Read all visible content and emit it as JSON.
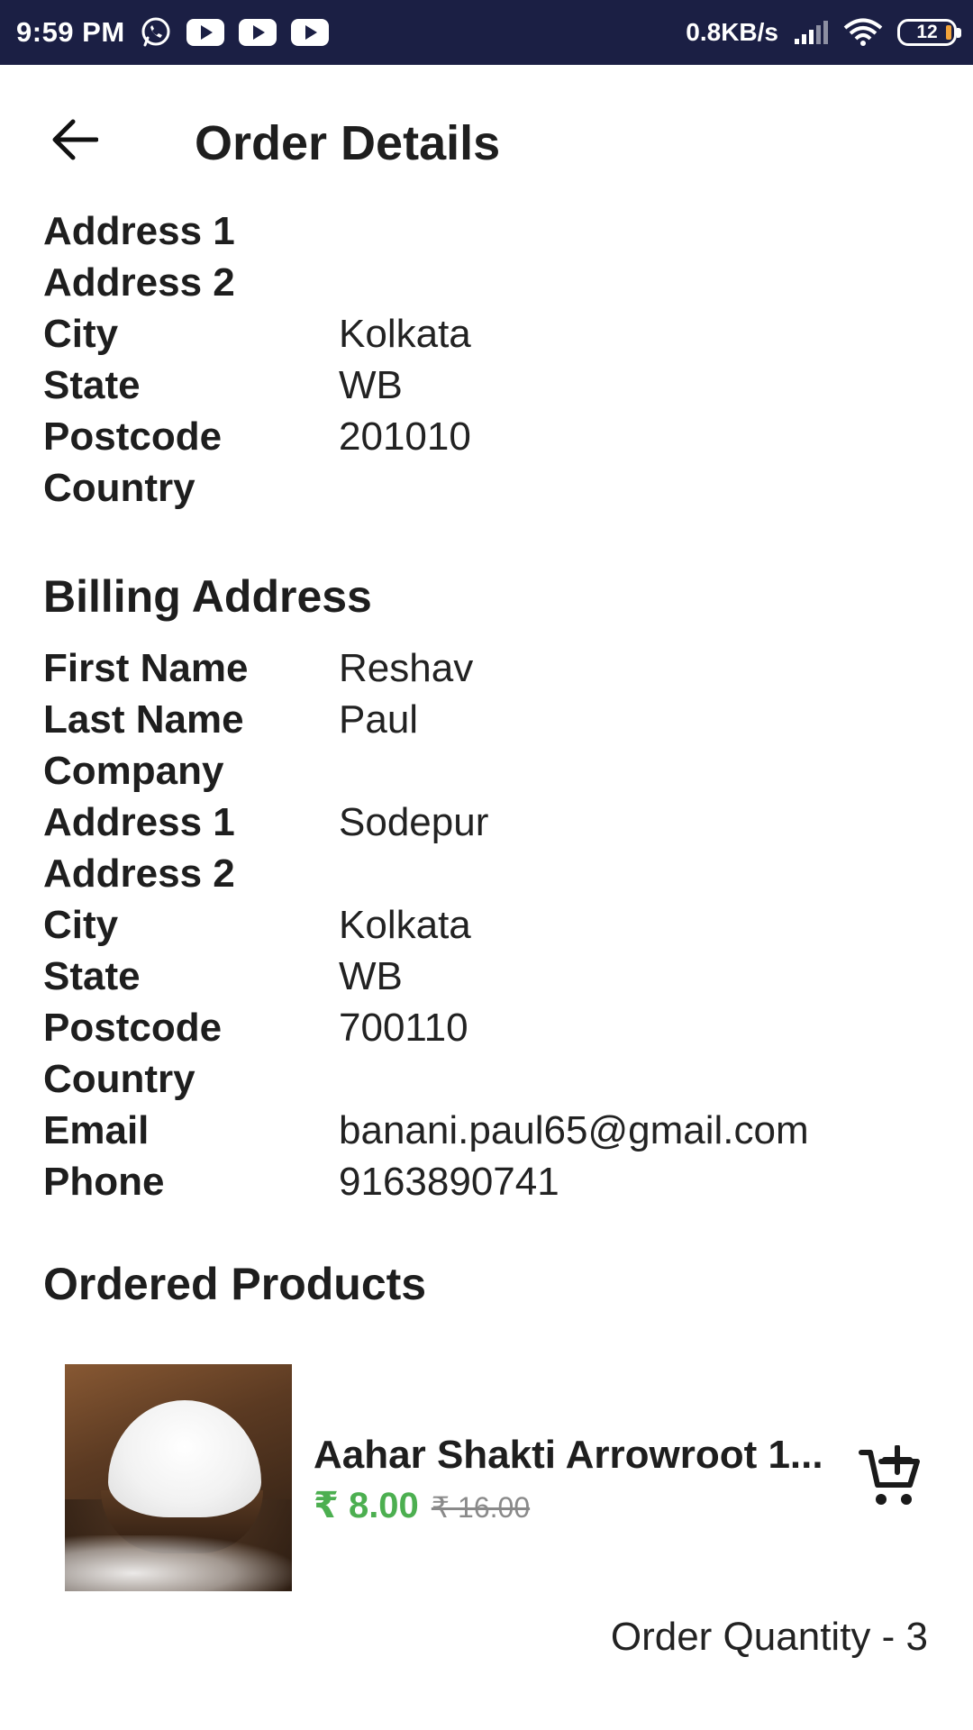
{
  "status_bar": {
    "time": "9:59 PM",
    "icons": [
      "whatsapp-icon",
      "youtube-icon",
      "youtube-icon",
      "youtube-icon"
    ],
    "net_speed": "0.8KB/s",
    "battery": "12"
  },
  "app_bar": {
    "back_icon": "arrow-left-icon",
    "title": "Order Details"
  },
  "shipping_address": {
    "rows": [
      {
        "label": "Address 1",
        "value": ""
      },
      {
        "label": "Address 2",
        "value": ""
      },
      {
        "label": "City",
        "value": "Kolkata"
      },
      {
        "label": "State",
        "value": "WB"
      },
      {
        "label": "Postcode",
        "value": "201010"
      },
      {
        "label": "Country",
        "value": ""
      }
    ]
  },
  "billing_address": {
    "title": "Billing Address",
    "rows": [
      {
        "label": "First Name",
        "value": "Reshav"
      },
      {
        "label": "Last Name",
        "value": "Paul"
      },
      {
        "label": "Company",
        "value": ""
      },
      {
        "label": "Address 1",
        "value": "Sodepur"
      },
      {
        "label": "Address 2",
        "value": ""
      },
      {
        "label": "City",
        "value": "Kolkata"
      },
      {
        "label": "State",
        "value": "WB"
      },
      {
        "label": "Postcode",
        "value": "700110"
      },
      {
        "label": "Country",
        "value": ""
      },
      {
        "label": "Email",
        "value": "banani.paul65@gmail.com"
      },
      {
        "label": "Phone",
        "value": "9163890741"
      }
    ]
  },
  "ordered_products": {
    "title": "Ordered Products",
    "items": [
      {
        "name": "Aahar Shakti Arrowroot 1...",
        "price": "₹ 8.00",
        "original_price": "₹ 16.00",
        "action_icon": "add-to-cart-icon"
      }
    ],
    "order_quantity": "Order Quantity - 3"
  },
  "colors": {
    "status_bar_bg": "#1b1f44",
    "price_green": "#4caf50",
    "strike_grey": "#8a8a8a"
  }
}
